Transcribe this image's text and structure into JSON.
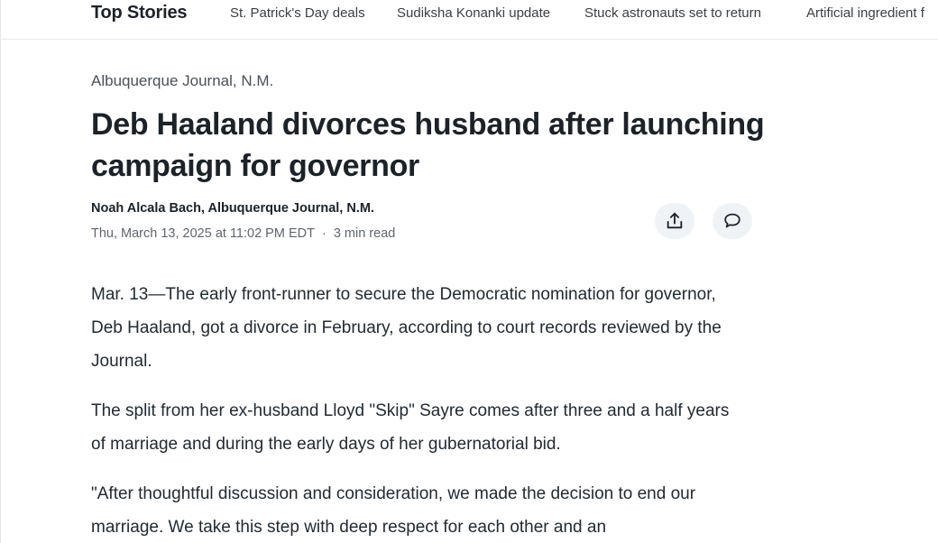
{
  "topnav": {
    "section_title": "Top Stories",
    "links": [
      "St. Patrick's Day deals",
      "Sudiksha Konanki update",
      "Stuck astronauts set to return",
      "Artificial ingredient f"
    ]
  },
  "article": {
    "source": "Albuquerque Journal, N.M.",
    "headline": "Deb Haaland divorces husband after launching campaign for governor",
    "byline": "Noah Alcala Bach, Albuquerque Journal, N.M.",
    "date": "Thu, March 13, 2025 at 11:02 PM EDT",
    "separator": "·",
    "read_time": "3 min read",
    "actions": {
      "share_icon": "share-icon",
      "comment_icon": "comment-icon"
    },
    "paragraphs": [
      "Mar. 13—The early front-runner to secure the Democratic nomination for governor, Deb Haaland, got a divorce in February, according to court records reviewed by the Journal.",
      "The split from her ex-husband Lloyd \"Skip\" Sayre comes after three and a half years of marriage and during the early days of her gubernatorial bid.",
      "\"After thoughtful discussion and consideration, we made the decision to end our marriage. We take this step with deep respect for each other and an"
    ]
  }
}
